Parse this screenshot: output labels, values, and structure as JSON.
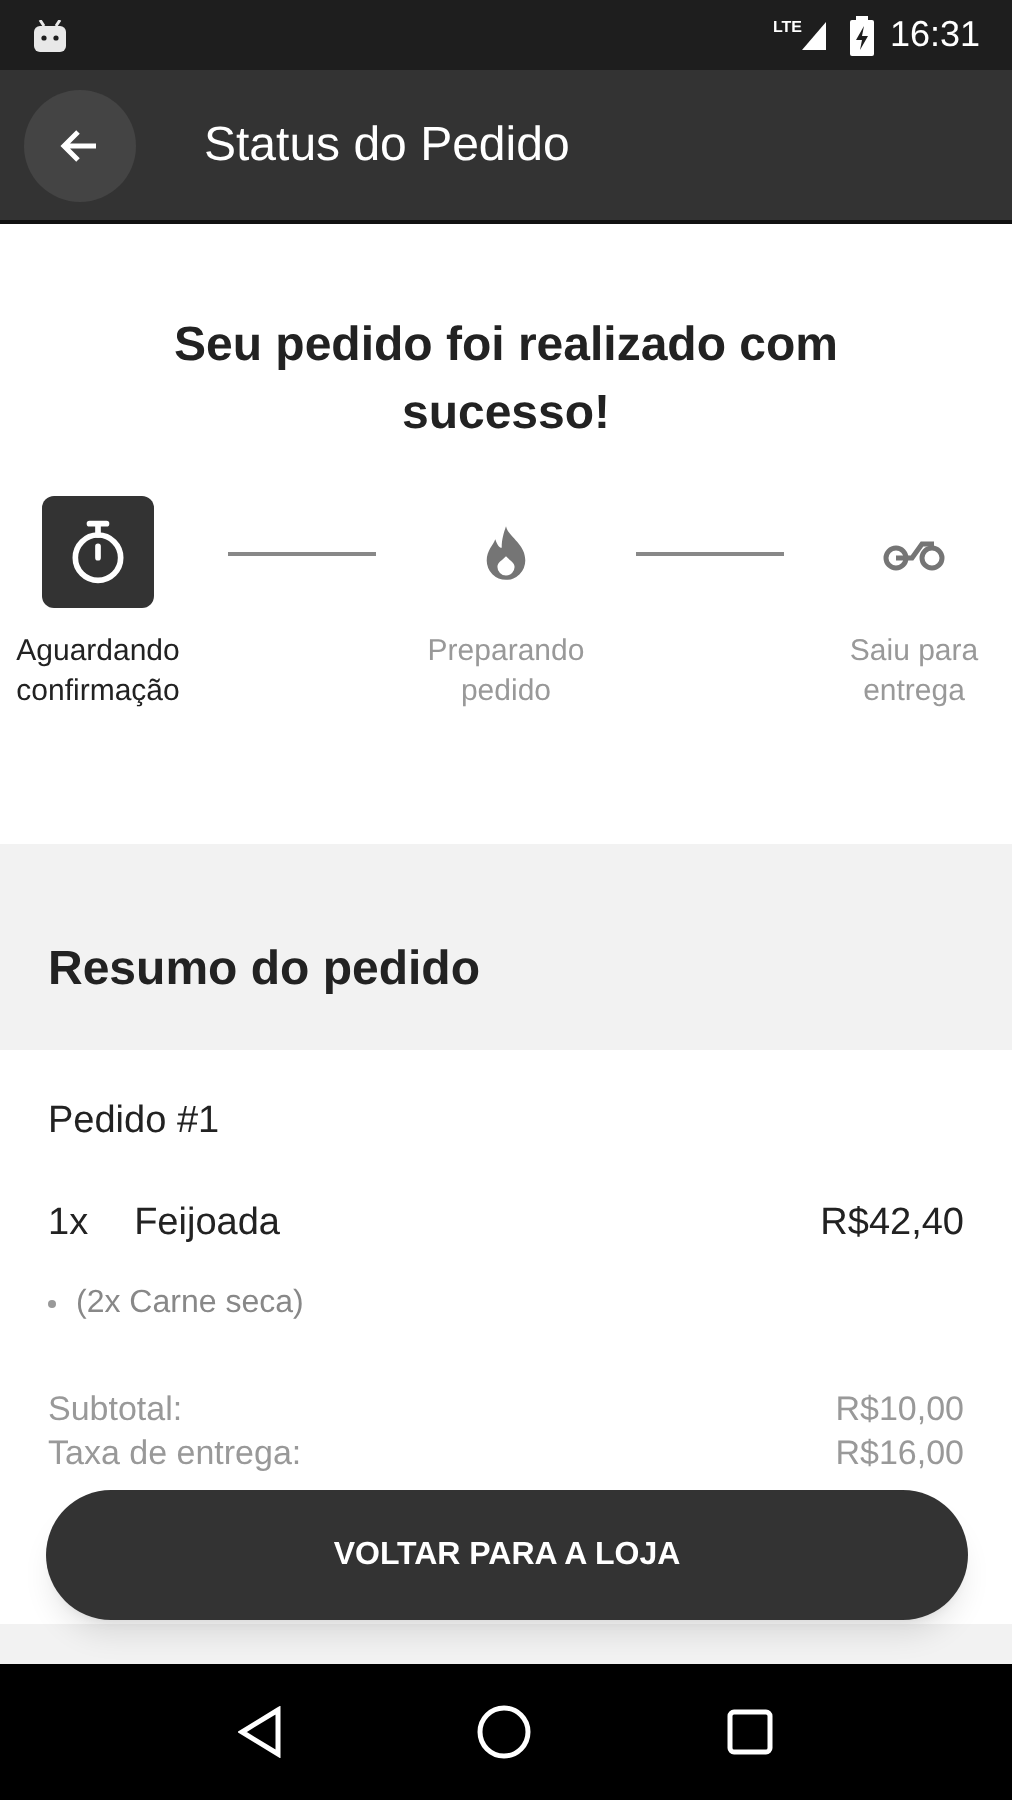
{
  "status_bar": {
    "network": "LTE",
    "time": "16:31"
  },
  "app_bar": {
    "title": "Status do Pedido"
  },
  "headline": "Seu pedido foi realizado com sucesso!",
  "steps": [
    {
      "kind": "timer",
      "label": "Aguardando confirmação",
      "active": true
    },
    {
      "kind": "fire",
      "label": "Preparando pedido",
      "active": false
    },
    {
      "kind": "motorcycle",
      "label": "Saiu para entrega",
      "active": false
    }
  ],
  "summary": {
    "title": "Resumo do pedido",
    "order": "Pedido #1",
    "items": [
      {
        "qty": "1x",
        "name": "Feijoada",
        "price": "R$42,40",
        "extras": [
          "(2x Carne seca)"
        ]
      }
    ],
    "totals": [
      {
        "label": "Subtotal:",
        "value": "R$10,00"
      },
      {
        "label": "Taxa de entrega:",
        "value": "R$16,00"
      }
    ]
  },
  "button": "VOLTAR PARA A LOJA"
}
